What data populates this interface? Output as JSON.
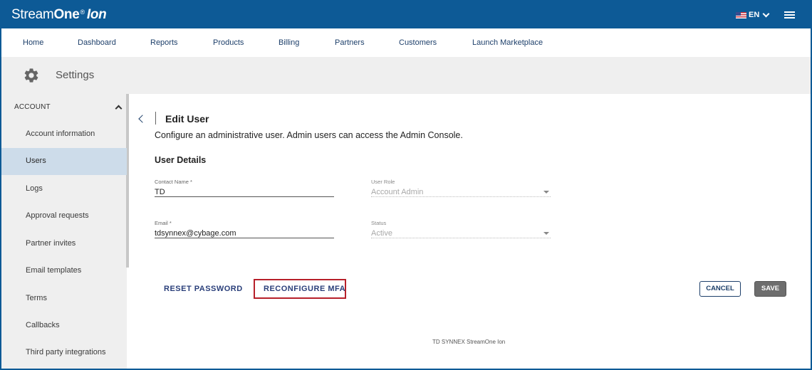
{
  "header": {
    "brand_part1": "Stream",
    "brand_part2": "One",
    "brand_reg": "®",
    "brand_part3": "Ion",
    "language": "EN"
  },
  "nav": {
    "items": [
      "Home",
      "Dashboard",
      "Reports",
      "Products",
      "Billing",
      "Partners",
      "Customers",
      "Launch Marketplace"
    ]
  },
  "settings": {
    "title": "Settings"
  },
  "sidebar": {
    "section": "ACCOUNT",
    "items": [
      "Account information",
      "Users",
      "Logs",
      "Approval requests",
      "Partner invites",
      "Email templates",
      "Terms",
      "Callbacks",
      "Third party integrations"
    ],
    "active": "Users"
  },
  "main": {
    "title": "Edit User",
    "description": "Configure an administrative user. Admin users can access the Admin Console.",
    "section_title": "User Details",
    "fields": {
      "contact_name": {
        "label": "Contact Name *",
        "value": "TD"
      },
      "user_role": {
        "label": "User Role",
        "value": "Account Admin"
      },
      "email": {
        "label": "Email *",
        "value": "tdsynnex@cybage.com"
      },
      "status": {
        "label": "Status",
        "value": "Active"
      }
    },
    "actions": {
      "reset_password": "RESET PASSWORD",
      "reconfigure_mfa": "RECONFIGURE MFA",
      "cancel": "CANCEL",
      "save": "SAVE"
    },
    "footer": "TD SYNNEX StreamOne Ion"
  },
  "colors": {
    "brand_blue": "#0d5a96",
    "highlight_red": "#b7202a",
    "active_item": "#cddcea"
  }
}
